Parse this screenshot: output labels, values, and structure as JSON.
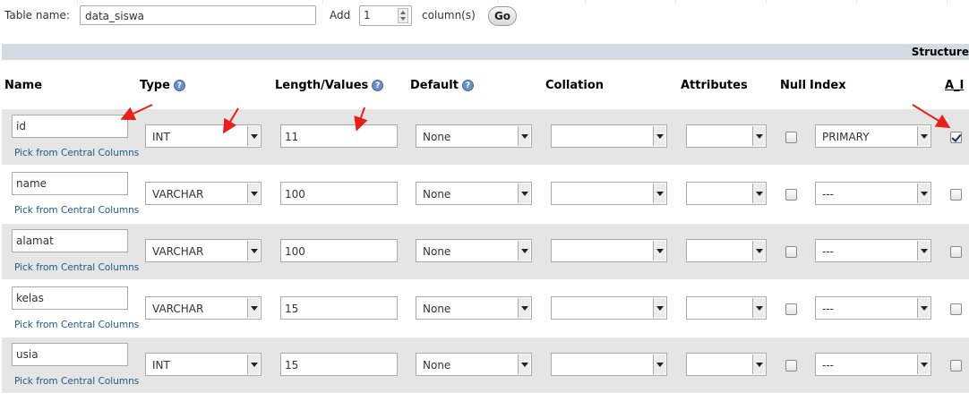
{
  "form": {
    "table_name_label": "Table name:",
    "table_name_value": "data_siswa",
    "add_label": "Add",
    "add_count": "1",
    "columns_label": "column(s)",
    "go_label": "Go"
  },
  "section_label": "Structure",
  "headers": {
    "name": "Name",
    "type": "Type",
    "length": "Length/Values",
    "default": "Default",
    "collation": "Collation",
    "attributes": "Attributes",
    "null": "Null",
    "index": "Index",
    "ai": "A_I"
  },
  "pick_label": "Pick from Central Columns",
  "rows": [
    {
      "name": "id",
      "type": "INT",
      "length": "11",
      "default": "None",
      "collation": "",
      "attributes": "",
      "null": false,
      "index": "PRIMARY",
      "ai": true
    },
    {
      "name": "name",
      "type": "VARCHAR",
      "length": "100",
      "default": "None",
      "collation": "",
      "attributes": "",
      "null": false,
      "index": "---",
      "ai": false
    },
    {
      "name": "alamat",
      "type": "VARCHAR",
      "length": "100",
      "default": "None",
      "collation": "",
      "attributes": "",
      "null": false,
      "index": "---",
      "ai": false
    },
    {
      "name": "kelas",
      "type": "VARCHAR",
      "length": "15",
      "default": "None",
      "collation": "",
      "attributes": "",
      "null": false,
      "index": "---",
      "ai": false
    },
    {
      "name": "usia",
      "type": "INT",
      "length": "15",
      "default": "None",
      "collation": "",
      "attributes": "",
      "null": false,
      "index": "---",
      "ai": false
    }
  ],
  "colors": {
    "band": "#d3dce3",
    "row_shade": "#e5e5e5",
    "link": "#235a81",
    "annotation_arrow": "#e8201c"
  },
  "icons": {
    "help": "help-icon",
    "dropdown": "chevron-down-icon",
    "annotation": "red-arrow-annotation"
  }
}
